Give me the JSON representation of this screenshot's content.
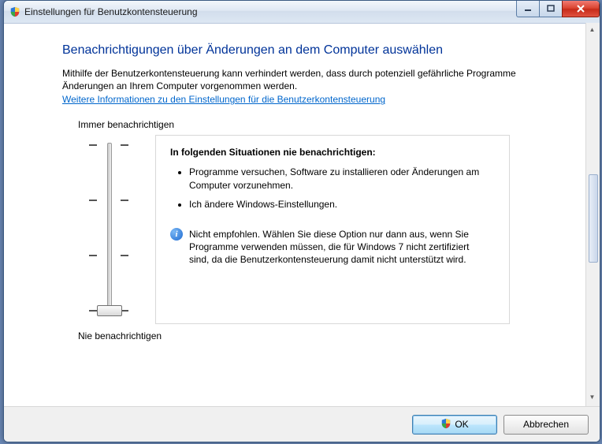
{
  "window": {
    "title": "Einstellungen für Benutzkontensteuerung"
  },
  "page": {
    "heading": "Benachrichtigungen über Änderungen an dem Computer auswählen",
    "intro": "Mithilfe der Benutzerkontensteuerung kann verhindert werden, dass durch potenziell gefährliche Programme Änderungen an Ihrem Computer vorgenommen werden.",
    "help_link": "Weitere Informationen zu den Einstellungen für die Benutzerkontensteuerung"
  },
  "slider": {
    "label_top": "Immer benachrichtigen",
    "label_bottom": "Nie benachrichtigen"
  },
  "detail": {
    "heading": "In folgenden Situationen nie benachrichtigen:",
    "bullets": [
      "Programme versuchen, Software zu installieren oder Änderungen am Computer vorzunehmen.",
      "Ich ändere Windows-Einstellungen."
    ],
    "note": "Nicht empfohlen. Wählen Sie diese Option nur dann aus, wenn Sie Programme verwenden müssen, die für Windows 7 nicht zertifiziert sind, da die Benutzerkontensteuerung damit nicht unterstützt wird.",
    "info_glyph": "i"
  },
  "buttons": {
    "ok": "OK",
    "cancel": "Abbrechen"
  }
}
